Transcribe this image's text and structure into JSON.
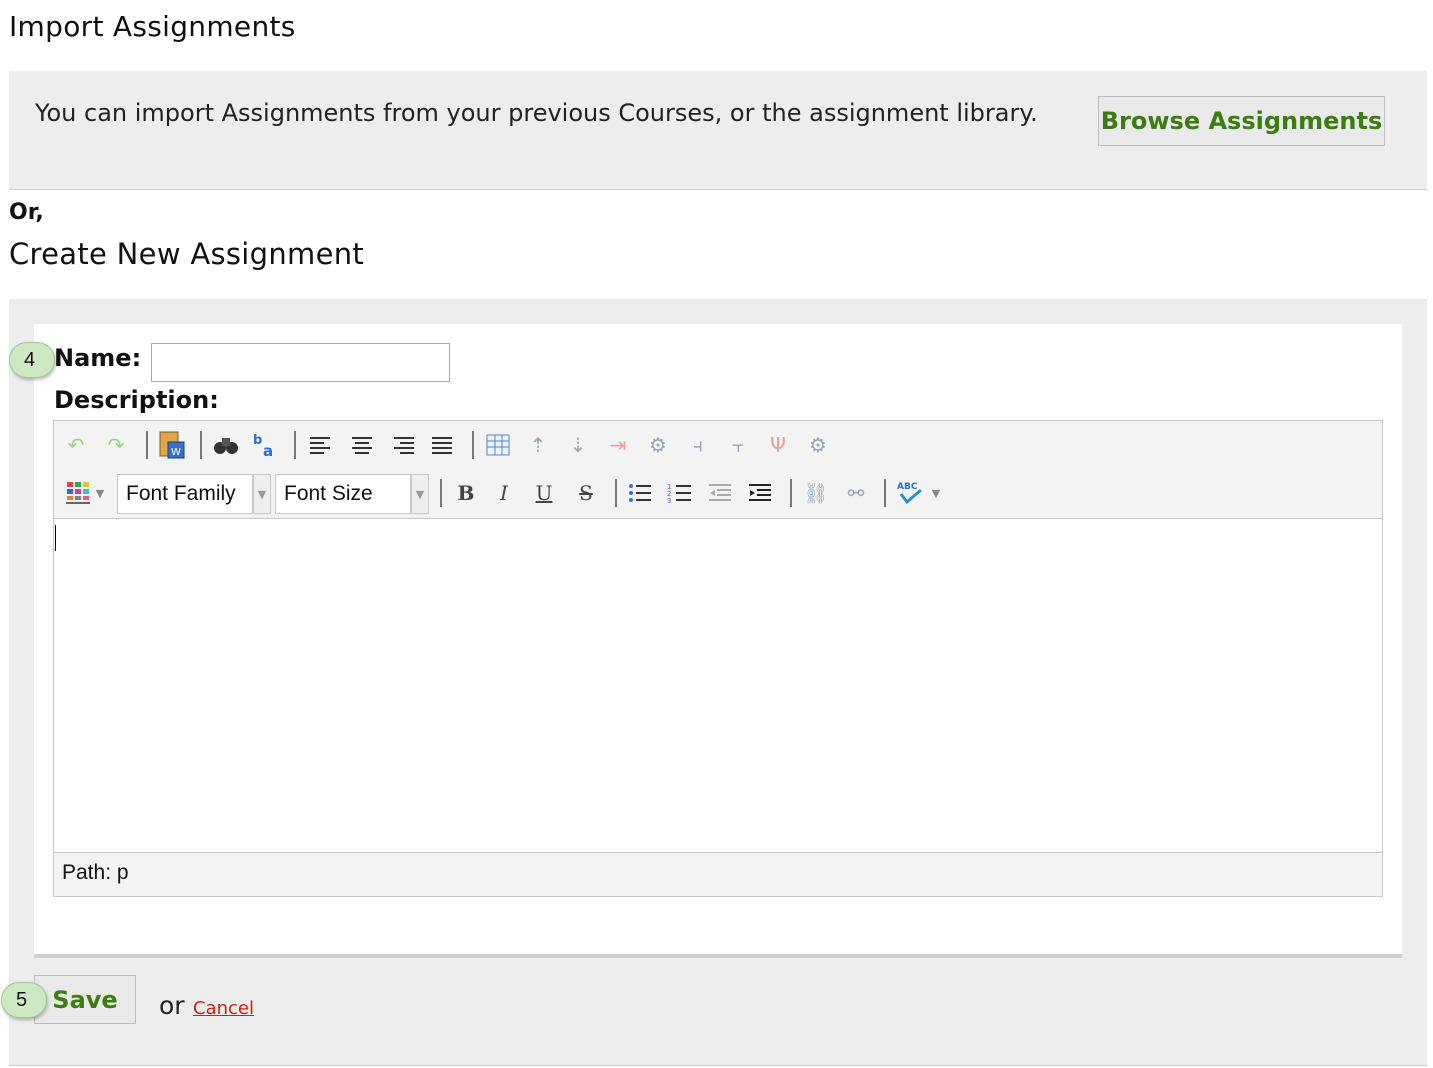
{
  "import_section": {
    "heading": "Import Assignments",
    "description": "You can import Assignments from your previous Courses, or the assignment library.",
    "browse_button": "Browse Assignments"
  },
  "or_label": "Or,",
  "create_section": {
    "heading": "Create New Assignment",
    "name_label": "Name:",
    "name_value": "",
    "description_label": "Description:",
    "font_family_select": "Font Family",
    "font_size_select": "Font Size",
    "path_text": "Path: p",
    "save_button": "Save",
    "or_text": "or",
    "cancel_link": "Cancel"
  },
  "callouts": {
    "name_step": "4",
    "save_step": "5"
  },
  "colors": {
    "accent_green": "#3a7d10",
    "cancel_red": "#d61a1a",
    "panel_gray": "#ededed",
    "callout_green": "#cfe8c4"
  }
}
